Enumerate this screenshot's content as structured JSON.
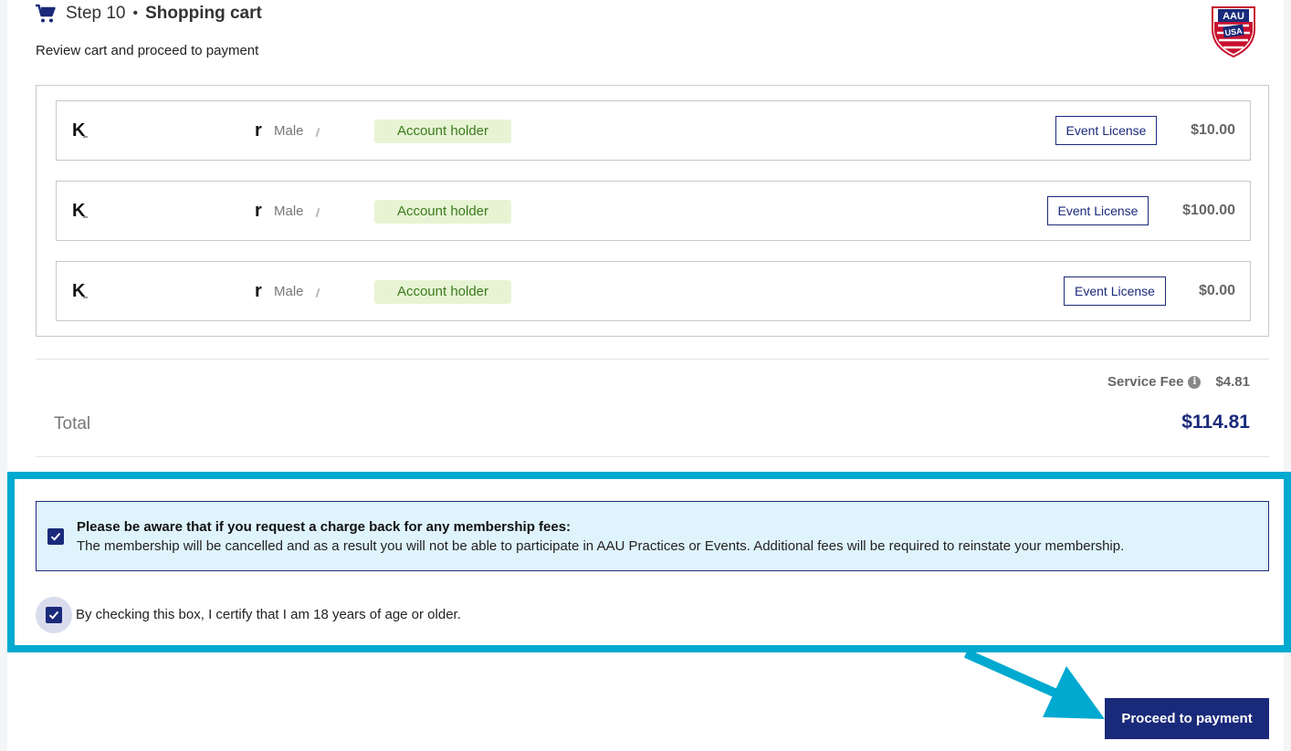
{
  "header": {
    "step_label": "Step 10",
    "separator": "•",
    "title": "Shopping cart",
    "subtitle": "Review cart and proceed to payment",
    "logo_alt": "AAU USA"
  },
  "cart": {
    "items": [
      {
        "initial": "K",
        "last_initial": "r",
        "gender": "Male",
        "badge": "Account holder",
        "license_label": "Event License",
        "price": "$10.00"
      },
      {
        "initial": "K",
        "last_initial": "r",
        "gender": "Male",
        "badge": "Account holder",
        "license_label": "Event License",
        "price": "$100.00"
      },
      {
        "initial": "K",
        "last_initial": "r",
        "gender": "Male",
        "badge": "Account holder",
        "license_label": "Event License",
        "price": "$0.00"
      }
    ]
  },
  "totals": {
    "service_fee_label": "Service Fee",
    "service_fee_value": "$4.81",
    "total_label": "Total",
    "total_value": "$114.81"
  },
  "agreements": {
    "chargeback_title": "Please be aware that if you request a charge back for any membership fees:",
    "chargeback_body": "The membership will be cancelled and as a result you will not be able to participate in AAU Practices or Events. Additional fees will be required to reinstate your membership.",
    "chargeback_checked": true,
    "age_label": "By checking this box, I certify that I am 18 years of age or older.",
    "age_checked": true
  },
  "actions": {
    "proceed_label": "Proceed to payment"
  },
  "colors": {
    "brand_navy": "#1a2a7a",
    "highlight_cyan": "#00a9d0",
    "badge_bg": "#e7f4d4",
    "badge_text": "#3c7a1e",
    "notice_bg": "#dff3fd"
  },
  "icons": {
    "cart": "shopping-cart-icon",
    "info": "info-icon",
    "check": "checkmark-icon",
    "annotation_arrow": "arrow-icon"
  }
}
